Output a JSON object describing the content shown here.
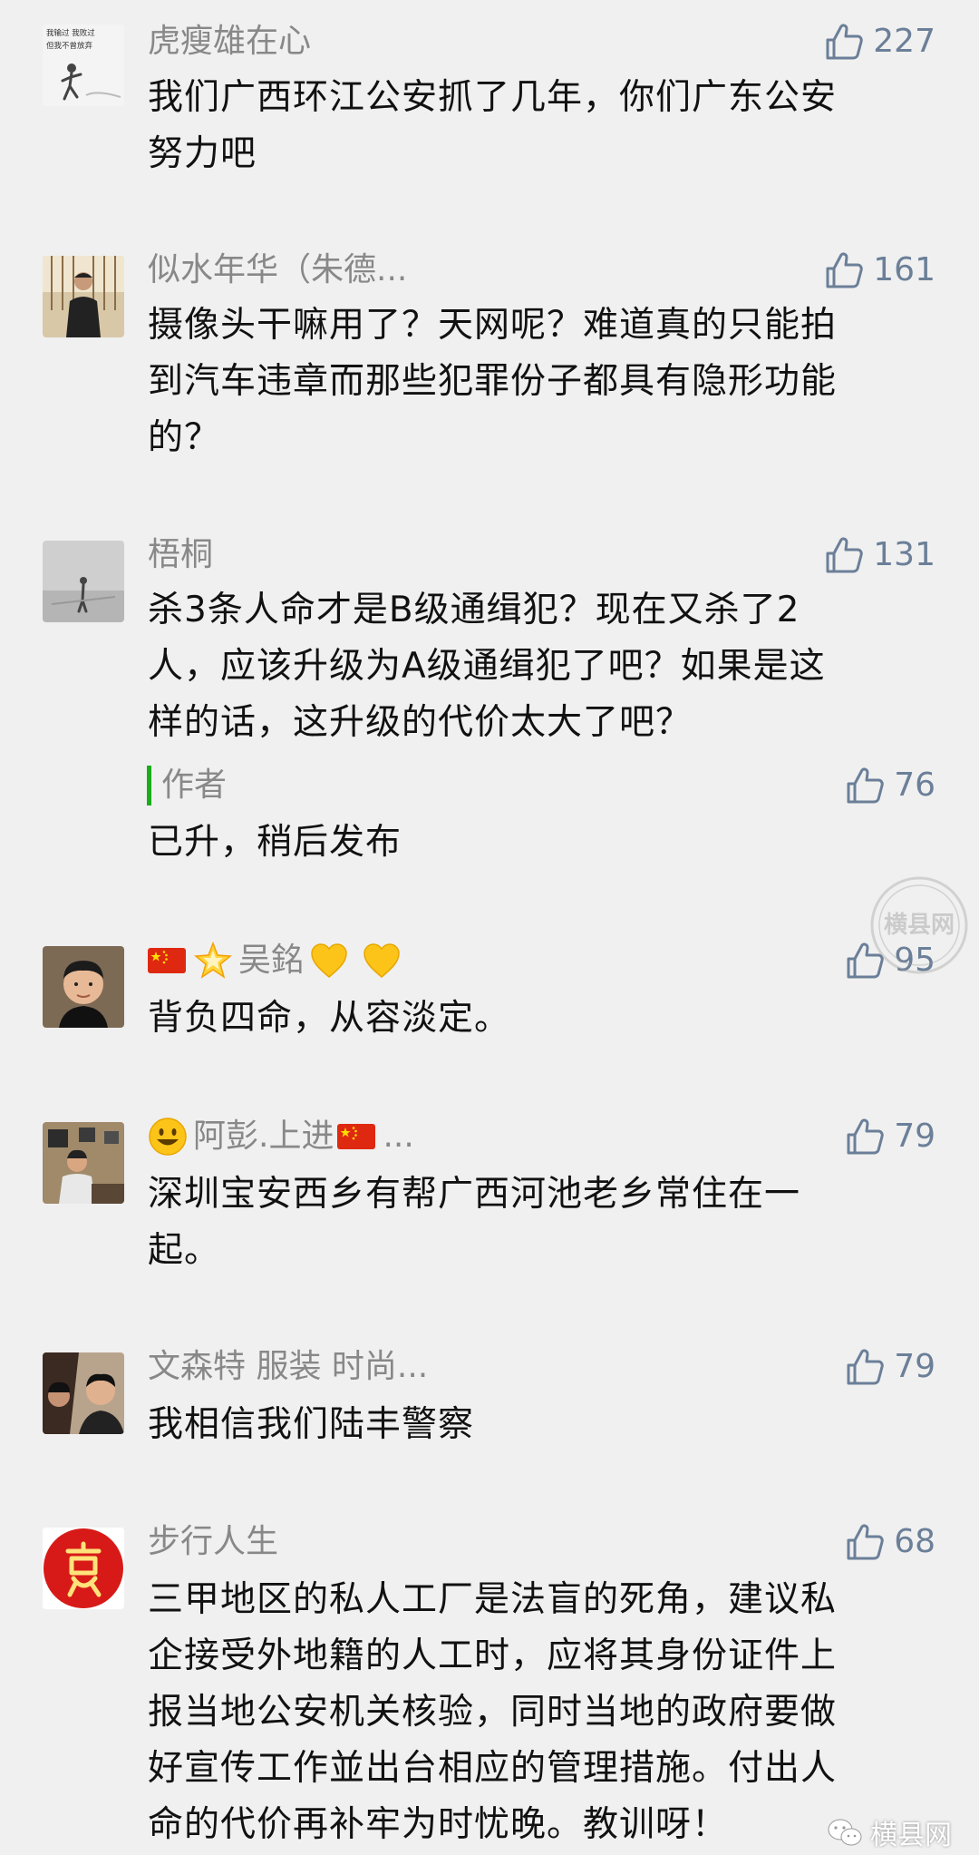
{
  "comments": [
    {
      "nickname": "虎瘦雄在心",
      "likes": "227",
      "lines": [
        "我们广西环江公安抓了几年，你们广东公安",
        "努力吧"
      ],
      "avatar_text": [
        "我输过 我败过",
        "但我不曾放弃"
      ]
    },
    {
      "nickname": "似水年华（朱德...",
      "likes": "161",
      "lines": [
        "摄像头干嘛用了？天网呢？难道真的只能拍",
        "到汽车违章而那些犯罪份子都具有隐形功能",
        "的？"
      ]
    },
    {
      "nickname": "梧桐",
      "likes": "131",
      "lines": [
        "杀3条人命才是B级通缉犯？现在又杀了2",
        "人，应该升级为A级通缉犯了吧？如果是这",
        "样的话，这升级的代价太大了吧？"
      ],
      "reply": {
        "author": "作者",
        "likes": "76",
        "text": "已升，稍后发布"
      }
    },
    {
      "nickname": "吴銘",
      "likes": "95",
      "lines": [
        "背负四命，从容淡定。"
      ]
    },
    {
      "nickname": "阿彭.上进",
      "nickname_suffix": "...",
      "likes": "79",
      "lines": [
        "深圳宝安西乡有帮广西河池老乡常住在一",
        "起。"
      ]
    },
    {
      "nickname": "文森特 服装 时尚...",
      "likes": "79",
      "lines": [
        "我相信我们陆丰警察"
      ]
    },
    {
      "nickname": "步行人生",
      "likes": "68",
      "lines": [
        "三甲地区的私人工厂是法盲的死角，建议私",
        "企接受外地籍的人工时，应将其身份证件上",
        "报当地公安机关核验，同时当地的政府要做",
        "好宣传工作並出台相应的管理措施。付出人",
        "命的代价再补牢为时忧晚。教训呀！"
      ]
    }
  ],
  "watermark": {
    "seal_text": "横县网",
    "bottom_text": "横县网"
  },
  "colors": {
    "background": "#f0f0f0",
    "nickname": "#888888",
    "like": "#6b7f98",
    "reply_bar": "#1aad19"
  },
  "icons": {
    "like": "thumbs-up-icon",
    "flag": "china-flag-icon",
    "heart": "yellow-heart-icon",
    "star": "glowing-star-icon",
    "smile": "smiley-face-icon"
  }
}
